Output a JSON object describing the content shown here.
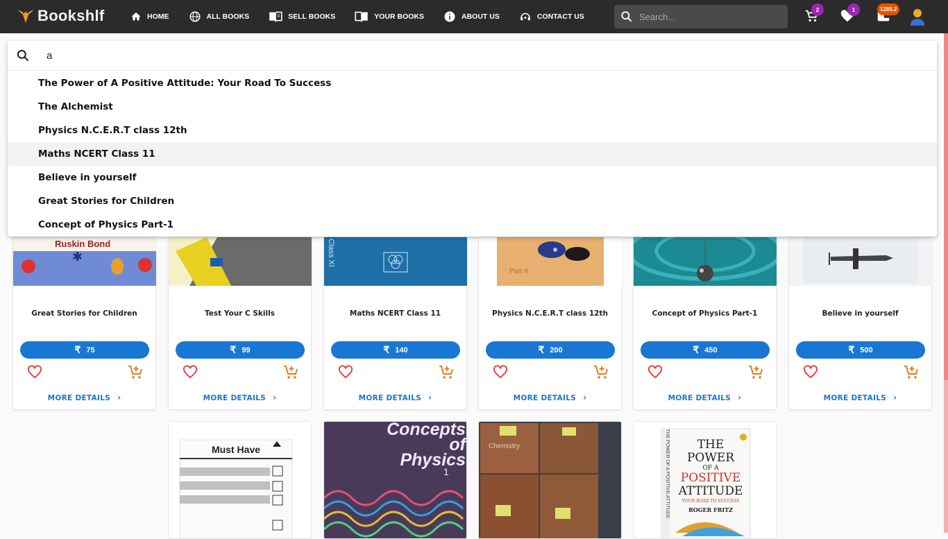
{
  "brand": {
    "name": "Bookshlf"
  },
  "nav": {
    "links": [
      {
        "label": "HOME",
        "icon": "home-icon"
      },
      {
        "label": "ALL BOOKS",
        "icon": "globe-icon"
      },
      {
        "label": "SELL BOOKS",
        "icon": "book-open-icon"
      },
      {
        "label": "YOUR BOOKS",
        "icon": "book-icon"
      },
      {
        "label": "ABOUT US",
        "icon": "info-icon"
      },
      {
        "label": "CONTACT US",
        "icon": "support-icon"
      }
    ],
    "search_placeholder": "Search...",
    "cart_count": "2",
    "wishlist_count": "1",
    "wallet_balance": "1285.2"
  },
  "search_dropdown": {
    "query": "a",
    "suggestions": [
      "The Power of A Positive Attitude: Your Road To Success",
      "The Alchemist",
      "Physics N.C.E.R.T class 12th",
      "Maths NCERT Class 11",
      "Believe in yourself",
      "Great Stories for Children",
      "Concept of Physics Part-1"
    ],
    "highlighted_index": 3
  },
  "books": [
    {
      "title": "Great Stories for Children",
      "price": "75",
      "cover_text": "Ruskin Bond"
    },
    {
      "title": "Test Your C Skills",
      "price": "99"
    },
    {
      "title": "Maths NCERT Class 11",
      "price": "140",
      "cover_text": "Class XI"
    },
    {
      "title": "Physics N.C.E.R.T class 12th",
      "price": "200",
      "cover_text": "Part II"
    },
    {
      "title": "Concept of Physics Part-1",
      "price": "450"
    },
    {
      "title": "Believe in yourself",
      "price": "500"
    }
  ],
  "more_details_label": "MORE DETAILS",
  "currency_symbol": "₹",
  "row2_covers": {
    "must_have": "Must Have",
    "concepts_title": "Concepts of Physics",
    "concepts_vol": "1",
    "chemistry": "Chemistry",
    "power_title": [
      "THE",
      "POWER",
      "OF A",
      "POSITIVE",
      "ATTITUDE"
    ],
    "power_subtitle": "YOUR ROAD TO SUCCESS",
    "power_author": "ROGER FRITZ",
    "power_spine": "THE POWER OF A POSITIVE ATTITUDE"
  }
}
